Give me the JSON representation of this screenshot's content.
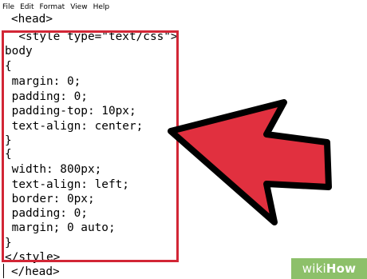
{
  "menu": {
    "items": [
      "File",
      "Edit",
      "Format",
      "View",
      "Help"
    ]
  },
  "code": {
    "lines": [
      "<head>",
      "  <style type=\"text/css\">",
      "body",
      "{",
      " margin: 0;",
      " padding: 0;",
      " padding-top: 10px;",
      " text-align: center;",
      "}",
      "{",
      " width: 800px;",
      " text-align: left;",
      " border: 0px;",
      " padding: 0;",
      " margin; 0 auto;",
      "}",
      "</style>",
      "</head>"
    ]
  },
  "watermark": {
    "wiki": "wiki",
    "how": "How"
  },
  "colors": {
    "highlight": "#d22636",
    "arrow_fill": "#e1303f",
    "watermark_bg": "#8dc06a"
  }
}
